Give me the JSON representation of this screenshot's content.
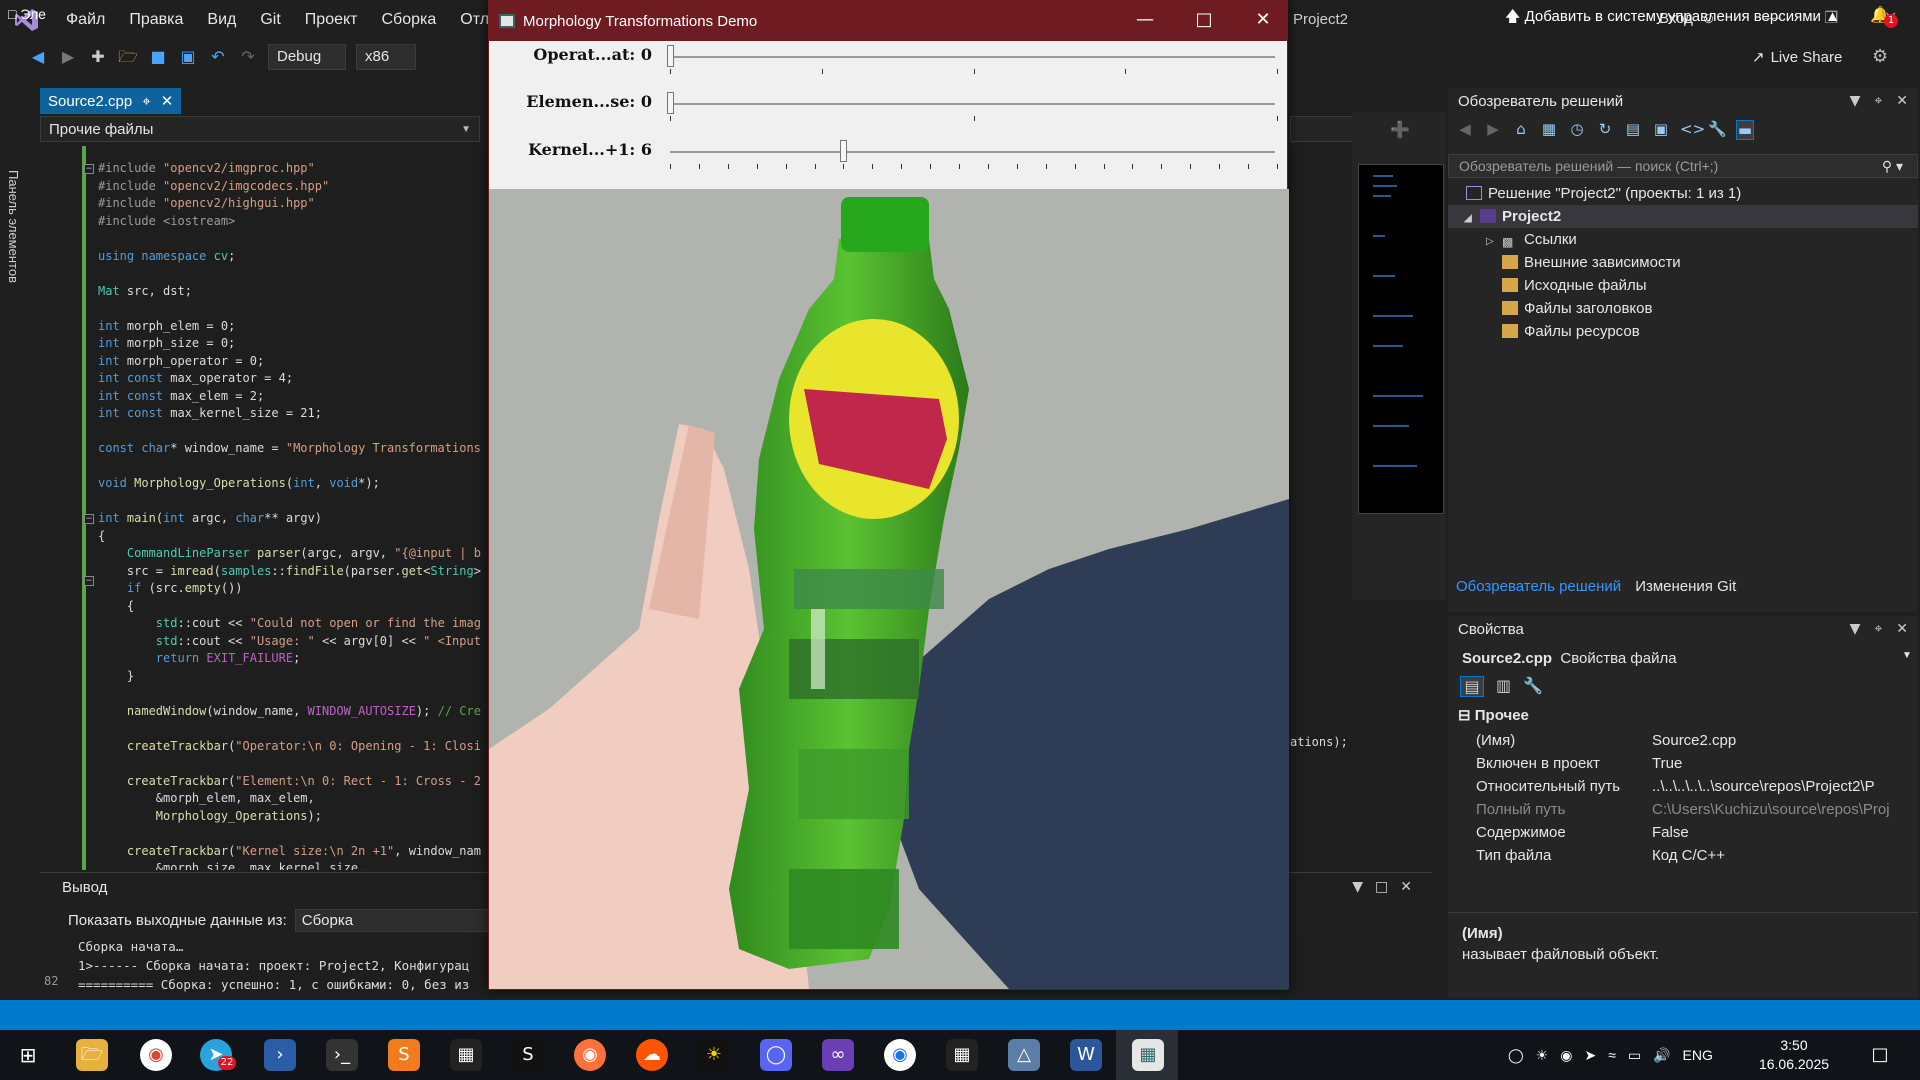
{
  "vs": {
    "menu": [
      "Файл",
      "Правка",
      "Вид",
      "Git",
      "Проект",
      "Сборка",
      "Отладка"
    ],
    "project_title": "Project2",
    "login": "Вход",
    "config": "Debug",
    "platform": "x86",
    "live_share": "Live Share",
    "toolbox_tab": "Панель элементов"
  },
  "editor": {
    "tab_label": "Source2.cpp",
    "nav_scope": "Прочие файлы",
    "overflow_text": "ations);"
  },
  "output": {
    "title": "Вывод",
    "show_from_label": "Показать выходные данные из:",
    "show_from_value": "Сборка",
    "lines": [
      "Сборка начата…",
      "1>------ Сборка начата: проект: Project2, Конфигурац",
      "========== Сборка: успешно: 1, с ошибками: 0, без из"
    ],
    "line_number": "82"
  },
  "statusbar": {
    "left": "Эле",
    "version_control": "Добавить в систему управления версиями",
    "notifications": "1"
  },
  "solution_explorer": {
    "title": "Обозреватель решений",
    "search_placeholder": "Обозреватель решений — поиск (Ctrl+;)",
    "solution": "Решение \"Project2\" (проекты: 1 из 1)",
    "project": "Project2",
    "items": [
      "Ссылки",
      "Внешние зависимости",
      "Исходные файлы",
      "Файлы заголовков",
      "Файлы ресурсов"
    ],
    "tab_active": "Обозреватель решений",
    "tab_inactive": "Изменения Git"
  },
  "properties": {
    "title": "Свойства",
    "object_name": "Source2.cpp",
    "object_type": "Свойства файла",
    "category": "Прочее",
    "rows": [
      {
        "key": "(Имя)",
        "value": "Source2.cpp"
      },
      {
        "key": "Включен в проект",
        "value": "True"
      },
      {
        "key": "Относительный путь",
        "value": "..\\..\\..\\..\\..\\source\\repos\\Project2\\P"
      },
      {
        "key": "Полный путь",
        "value": "C:\\Users\\Kuchizu\\source\\repos\\Proj"
      },
      {
        "key": "Содержимое",
        "value": "False"
      },
      {
        "key": "Тип файла",
        "value": "Код C/C++"
      }
    ],
    "desc_title": "(Имя)",
    "desc_text": "называет файловый объект."
  },
  "cv_window": {
    "title": "Morphology Transformations Demo",
    "trackbars": [
      {
        "label": "Operat...at: 0",
        "value": 0,
        "max": 4
      },
      {
        "label": "Elemen...se: 0",
        "value": 0,
        "max": 2
      },
      {
        "label": "Kernel...+1: 6",
        "value": 6,
        "max": 21
      }
    ]
  },
  "taskbar": {
    "time": "3:50",
    "date": "16.06.2025",
    "lang": "ENG",
    "telegram_badge": "22"
  },
  "colors": {
    "vs_accent": "#007acc",
    "cv_titlebar": "#6e1c21",
    "vs_purple": "#a88ad8"
  }
}
